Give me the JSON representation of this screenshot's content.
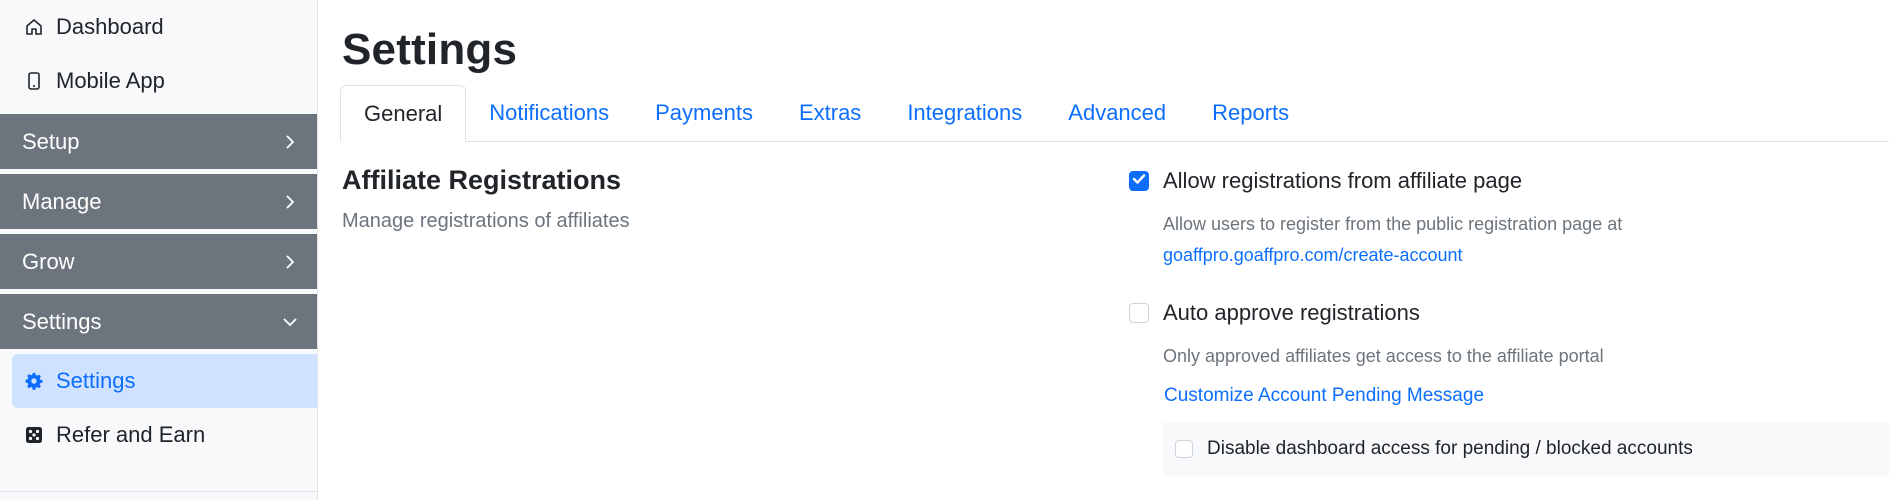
{
  "sidebar": {
    "top_links": [
      {
        "label": "Dashboard",
        "icon": "home-icon"
      },
      {
        "label": "Mobile App",
        "icon": "mobile-phone-icon"
      }
    ],
    "groups": [
      {
        "label": "Setup",
        "icon": "chevron-right-icon"
      },
      {
        "label": "Manage",
        "icon": "chevron-right-icon"
      },
      {
        "label": "Grow",
        "icon": "chevron-right-icon"
      },
      {
        "label": "Settings",
        "icon": "chevron-down-icon"
      }
    ],
    "sub_items": [
      {
        "label": "Settings",
        "icon": "gear-icon",
        "active": true
      },
      {
        "label": "Refer and Earn",
        "icon": "dice-icon",
        "active": false
      }
    ]
  },
  "page": {
    "title": "Settings"
  },
  "tabs": [
    "General",
    "Notifications",
    "Payments",
    "Extras",
    "Integrations",
    "Advanced",
    "Reports"
  ],
  "active_tab": "General",
  "section": {
    "title": "Affiliate Registrations",
    "description": "Manage registrations of affiliates"
  },
  "options": {
    "allow_registrations": {
      "label": "Allow registrations from affiliate page",
      "checked": true,
      "help": "Allow users to register from the public registration page at",
      "link": "goaffpro.goaffpro.com/create-account"
    },
    "auto_approve": {
      "label": "Auto approve registrations",
      "checked": false,
      "help": "Only approved affiliates get access to the affiliate portal",
      "link": "Customize Account Pending Message"
    },
    "disable_dashboard": {
      "label": "Disable dashboard access for pending / blocked accounts",
      "checked": false
    }
  },
  "colors": {
    "accent": "#0d6efd",
    "sidebar_group_bg": "#6c757d",
    "sidebar_active_bg": "#cfe2ff"
  }
}
